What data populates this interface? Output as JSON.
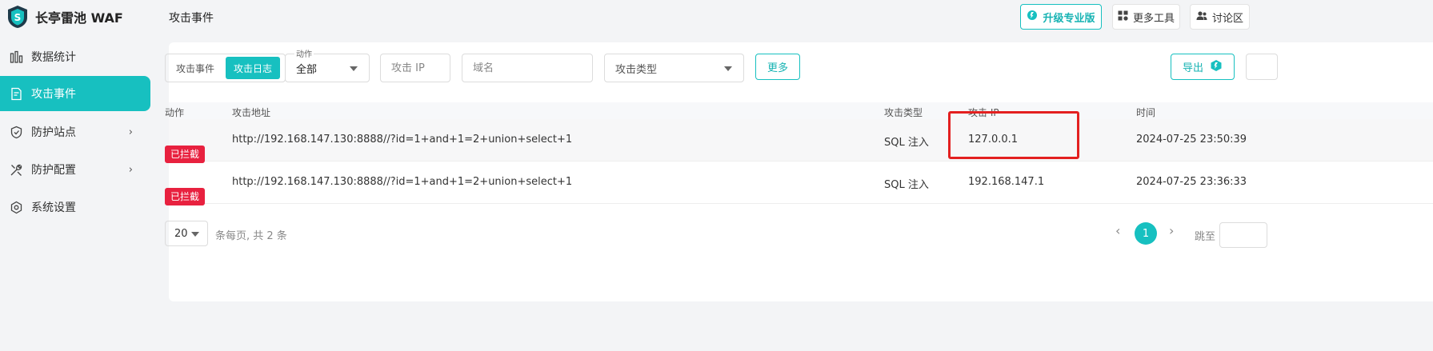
{
  "app": {
    "name": "长亭雷池 WAF"
  },
  "sidebar": {
    "items": [
      {
        "label": "数据统计",
        "icon": "bar-chart-icon",
        "active": false,
        "has_children": false
      },
      {
        "label": "攻击事件",
        "icon": "document-icon",
        "active": true,
        "has_children": false
      },
      {
        "label": "防护站点",
        "icon": "shield-check-icon",
        "active": false,
        "has_children": true
      },
      {
        "label": "防护配置",
        "icon": "tools-icon",
        "active": false,
        "has_children": true
      },
      {
        "label": "系统设置",
        "icon": "gear-icon",
        "active": false,
        "has_children": false
      }
    ]
  },
  "header": {
    "title": "攻击事件",
    "upgrade_label": "升级专业版",
    "tools_label": "更多工具",
    "forum_label": "讨论区"
  },
  "filters": {
    "segment": {
      "options": [
        "攻击事件",
        "攻击日志"
      ],
      "selected": "攻击日志"
    },
    "action": {
      "label": "动作",
      "value": "全部"
    },
    "ip_placeholder": "攻击 IP",
    "domain_placeholder": "域名",
    "attack_type_placeholder": "攻击类型",
    "more_label": "更多",
    "export_label": "导出"
  },
  "table": {
    "columns": [
      "动作",
      "攻击地址",
      "攻击类型",
      "攻击 IP",
      "时间"
    ],
    "rows": [
      {
        "action": "已拦截",
        "url": "http://192.168.147.130:8888//?id=1+and+1=2+union+select+1",
        "type": "SQL 注入",
        "ip": "127.0.0.1",
        "time": "2024-07-25 23:50:39"
      },
      {
        "action": "已拦截",
        "url": "http://192.168.147.130:8888//?id=1+and+1=2+union+select+1",
        "type": "SQL 注入",
        "ip": "192.168.147.1",
        "time": "2024-07-25 23:36:33"
      }
    ]
  },
  "pagination": {
    "page_size": "20",
    "summary": "条每页, 共 2 条",
    "current_page": "1",
    "jump_label": "跳至"
  },
  "colors": {
    "accent": "#17c0c0",
    "danger": "#e8213f",
    "highlight_box": "#e32020"
  }
}
